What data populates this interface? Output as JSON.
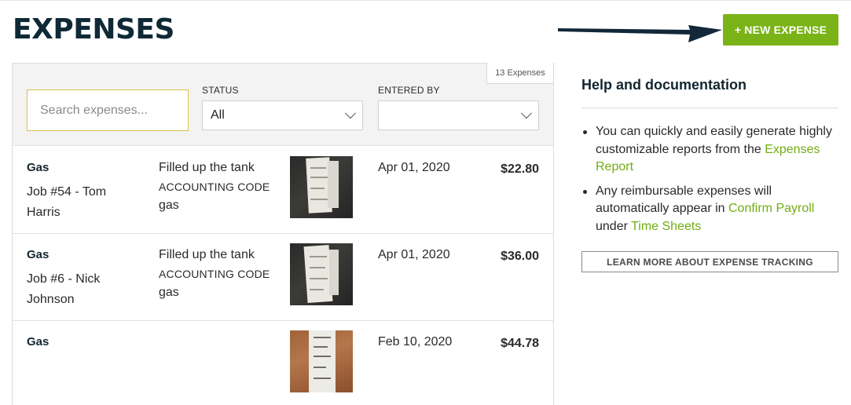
{
  "header": {
    "title": "EXPENSES",
    "new_button_label": "+ NEW EXPENSE"
  },
  "filters": {
    "count_label": "13 Expenses",
    "search_placeholder": "Search expenses...",
    "status_label": "STATUS",
    "status_value": "All",
    "entered_by_label": "ENTERED BY",
    "entered_by_value": ""
  },
  "expenses": [
    {
      "category": "Gas",
      "job": "Job #54 - Tom Harris",
      "description": "Filled up the tank",
      "code_label": "ACCOUNTING CODE",
      "code": "gas",
      "receipt": "dark",
      "date": "Apr 01, 2020",
      "amount": "$22.80"
    },
    {
      "category": "Gas",
      "job": "Job #6 - Nick Johnson",
      "description": "Filled up the tank",
      "code_label": "ACCOUNTING CODE",
      "code": "gas",
      "receipt": "dark",
      "date": "Apr 01, 2020",
      "amount": "$36.00"
    },
    {
      "category": "Gas",
      "job": "",
      "description": "",
      "code_label": "",
      "code": "",
      "receipt": "wood",
      "date": "Feb 10, 2020",
      "amount": "$44.78"
    }
  ],
  "help": {
    "title": "Help and documentation",
    "item1_text": "You can quickly and easily generate highly customizable reports from the ",
    "item1_link": "Expenses Report",
    "item2_text_a": "Any reimbursable expenses will automatically appear in ",
    "item2_link_a": "Confirm Payroll",
    "item2_text_b": " under ",
    "item2_link_b": "Time Sheets",
    "learn_more_label": "LEARN MORE ABOUT EXPENSE TRACKING"
  },
  "colors": {
    "accent_green": "#7ab317",
    "link_green": "#72ad12",
    "title_navy": "#0f2a36",
    "arrow_navy": "#12283a"
  }
}
